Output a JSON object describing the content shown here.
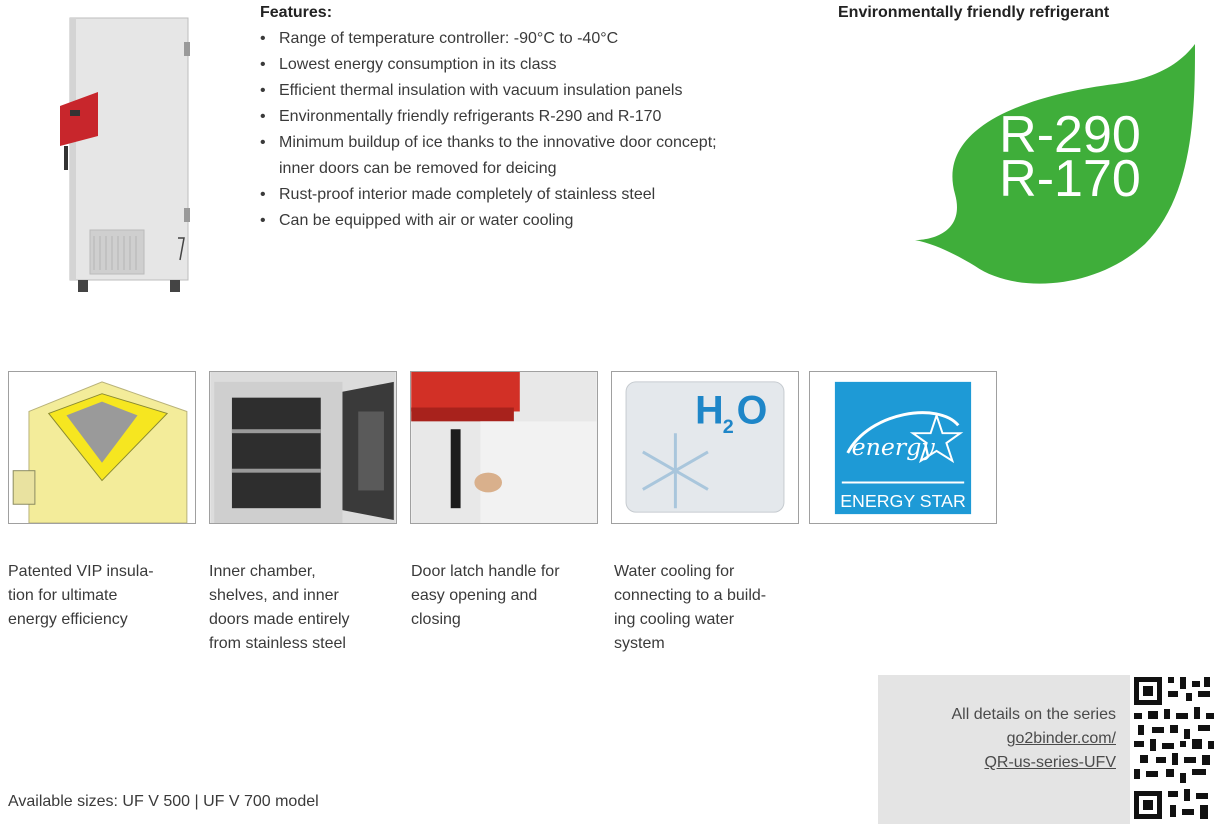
{
  "features": {
    "heading": "Features:",
    "items": [
      "Range of temperature controller: -90°C to -40°C",
      "Lowest energy consumption in its class",
      "Efficient thermal insulation with vacuum insulation panels",
      "Environmentally friendly refrigerants R-290 and R-170",
      "Minimum buildup of ice thanks to the innovative door concept; inner doors can be removed for deicing",
      "Rust-proof interior made completely of stainless steel",
      "Can be equipped with air or water cooling"
    ]
  },
  "refrigerant": {
    "title": "Environmentally friendly refrigerant",
    "line1": "R-290",
    "line2": "R-170",
    "leaf_color": "#3fae3a"
  },
  "thumbnails": {
    "h2o_h": "H",
    "h2o_2": "2",
    "h2o_o": "O",
    "energy_star_label": "ENERGY STAR",
    "energy_script": "energy",
    "energy_color": "#1e9ad6"
  },
  "captions": [
    "Patented VIP insula-\ntion for ultimate\nenergy efficiency",
    "Inner chamber,\nshelves, and inner\ndoors made entirely\nfrom stainless steel",
    "Door latch handle for\neasy opening and\nclosing",
    "Water cooling for\nconnecting to a build-\ning cooling water\nsystem"
  ],
  "bottom": {
    "sizes": "Available sizes: UF V 500 | UF V 700 model",
    "details_label": "All details on the series",
    "details_link": "go2binder.com/\nQR-us-series-UFV"
  },
  "colors": {
    "accent_red": "#c8262c",
    "box_gray": "#e4e4e4"
  }
}
